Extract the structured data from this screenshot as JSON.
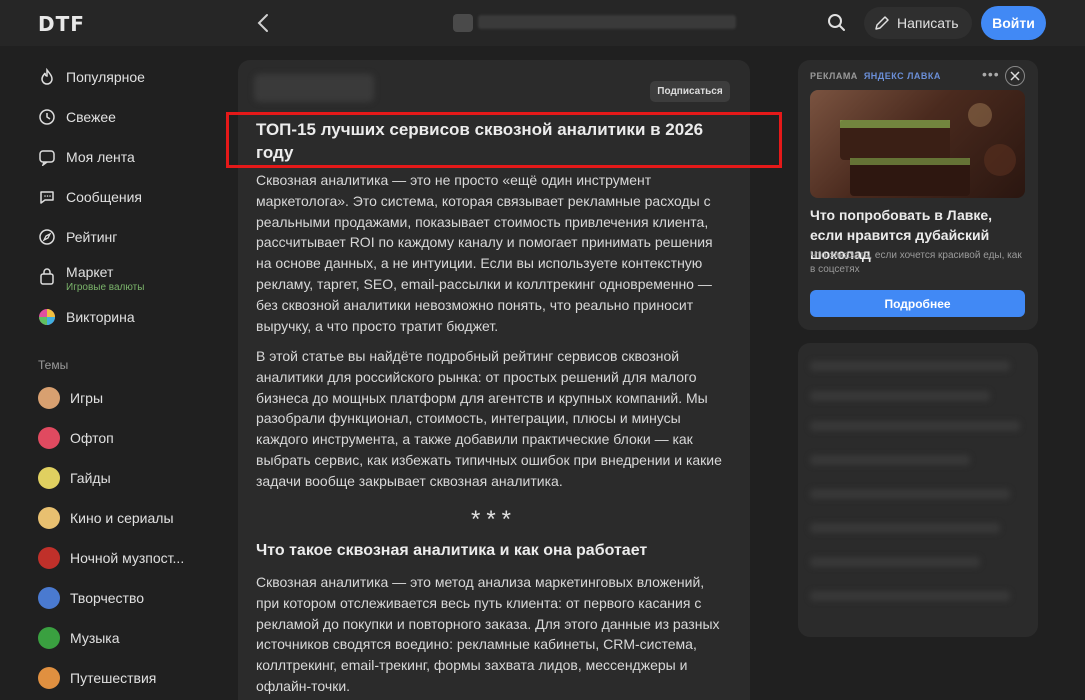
{
  "header": {
    "logo": "DTF",
    "write_label": "Написать",
    "login_label": "Войти"
  },
  "sidebar": {
    "items": [
      {
        "label": "Популярное",
        "icon": "fire-icon"
      },
      {
        "label": "Свежее",
        "icon": "clock-icon"
      },
      {
        "label": "Моя лента",
        "icon": "feed-icon"
      },
      {
        "label": "Сообщения",
        "icon": "chat-icon"
      },
      {
        "label": "Рейтинг",
        "icon": "compass-icon"
      },
      {
        "label": "Маркет",
        "sublabel": "Игровые валюты",
        "icon": "bag-icon"
      },
      {
        "label": "Викторина",
        "icon": "quiz-icon"
      }
    ],
    "topics_label": "Темы",
    "topics": [
      {
        "label": "Игры",
        "color": "#d8a070"
      },
      {
        "label": "Офтоп",
        "color": "#e04a60"
      },
      {
        "label": "Гайды",
        "color": "#e0d060"
      },
      {
        "label": "Кино и сериалы",
        "color": "#e8c070"
      },
      {
        "label": "Ночной музпост...",
        "color": "#c0302a"
      },
      {
        "label": "Творчество",
        "color": "#4a7ad0"
      },
      {
        "label": "Музыка",
        "color": "#3aa040"
      },
      {
        "label": "Путешествия",
        "color": "#e09040"
      }
    ]
  },
  "article": {
    "subscribe_label": "Подписаться",
    "title": "ТОП-15 лучших сервисов сквозной аналитики в 2026 году",
    "paragraph1": "Сквозная аналитика — это не просто «ещё один инструмент маркетолога». Это система, которая связывает рекламные расходы с реальными продажами, показывает стоимость привлечения клиента, рассчитывает ROI по каждому каналу и помогает принимать решения на основе данных, а не интуиции. Если вы используете контекстную рекламу, таргет, SEO, email-рассылки и коллтрекинг одновременно — без сквозной аналитики невозможно понять, что реально приносит выручку, а что просто тратит бюджет.",
    "paragraph2": "В этой статье вы найдёте подробный рейтинг сервисов сквозной аналитики для российского рынка: от простых решений для малого бизнеса до мощных платформ для агентств и крупных компаний. Мы разобрали функционал, стоимость, интеграции, плюсы и минусы каждого инструмента, а также добавили практические блоки — как выбрать сервис, как избежать типичных ошибок при внедрении и какие задачи вообще закрывает сквозная аналитика.",
    "separator": "***",
    "subheading": "Что такое сквозная аналитика и как она работает",
    "paragraph3": "Сквозная аналитика — это метод анализа маркетинговых вложений, при котором отслеживается весь путь клиента: от первого касания с рекламой до покупки и повторного заказа. Для этого данные из разных источников сводятся воедино: рекламные кабинеты, CRM-система, коллтрекинг, email-трекинг, формы захвата лидов, мессенджеры и офлайн-точки."
  },
  "ad": {
    "label": "РЕКЛАМА",
    "brand": "ЯНДЕКС ЛАВКА",
    "title": "Что попробовать в Лавке, если нравится дубайский шоколад",
    "description": "Что заказать, если хочется красивой еды, как в соцсетях",
    "button_label": "Подробнее"
  },
  "colors": {
    "accent": "#4189f5",
    "highlight": "#e51919",
    "background": "#202020",
    "card": "#2b2b2b"
  }
}
